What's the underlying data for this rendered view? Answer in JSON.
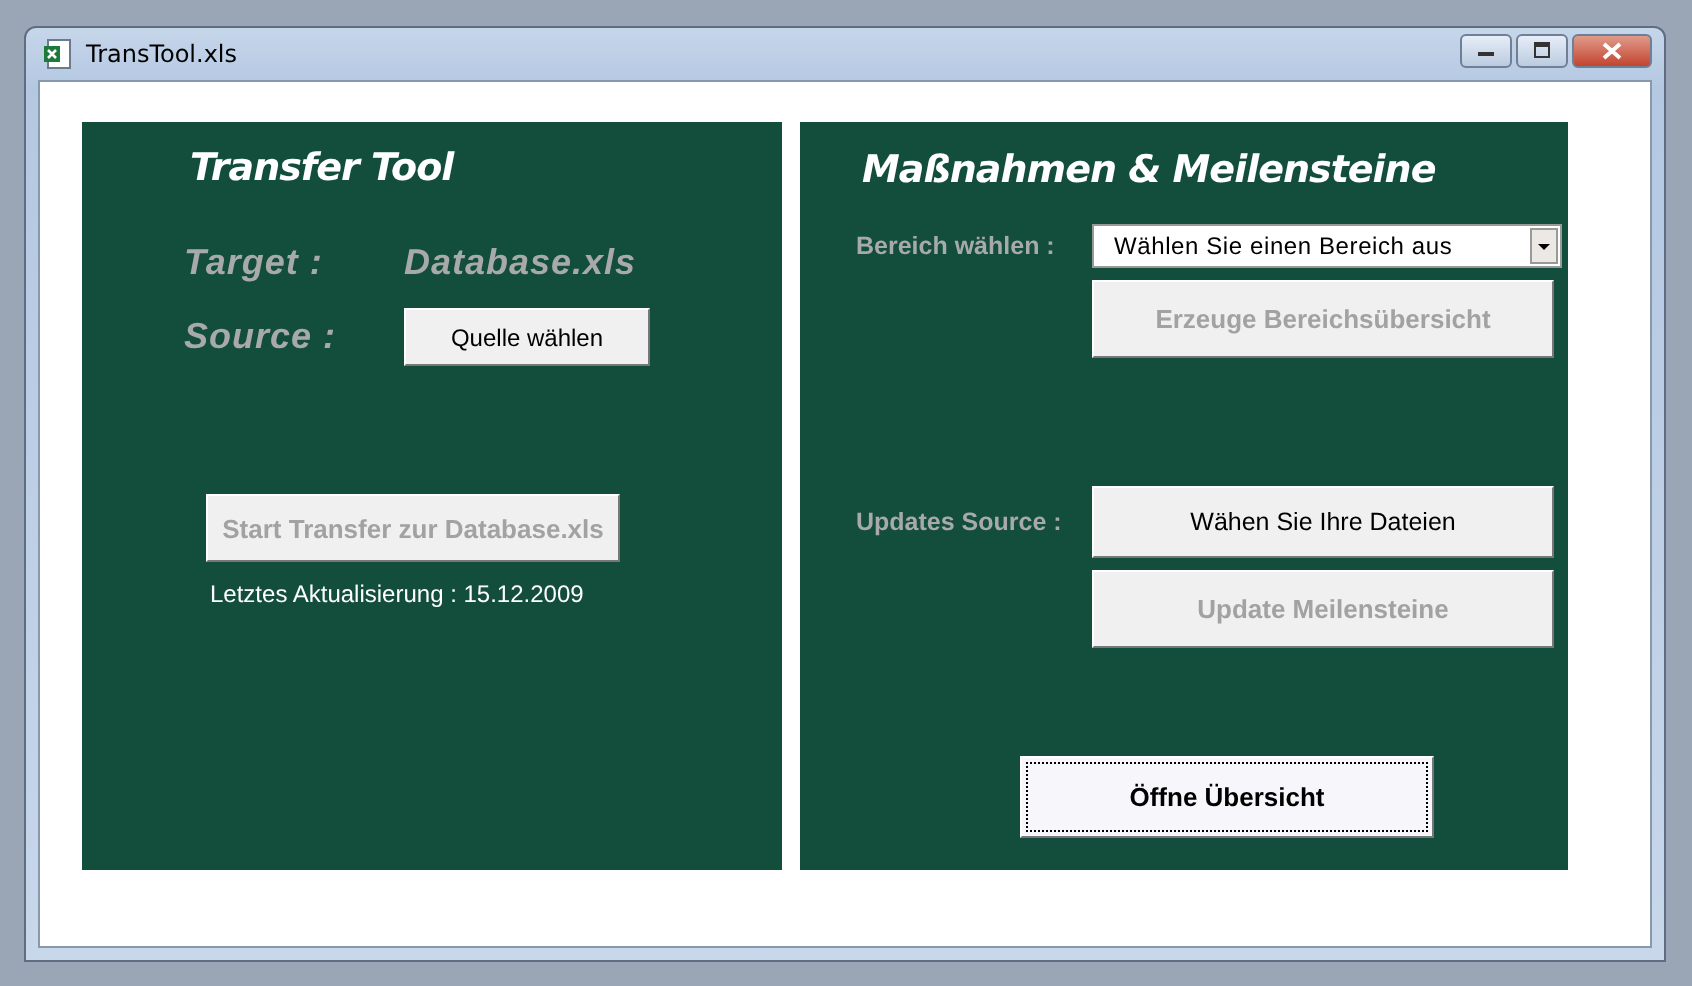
{
  "window": {
    "title": "TransTool.xls"
  },
  "transfer_panel": {
    "title": "Transfer Tool",
    "target": {
      "label": "Target :",
      "value": "Database.xls"
    },
    "source": {
      "label": "Source :",
      "button": {
        "label": "Quelle wählen",
        "disabled": false,
        "focused": false
      }
    },
    "start_button": {
      "label": "Start Transfer zur Database.xls",
      "disabled": true,
      "focused": false
    },
    "last_update": "Letztes Aktualisierung : 15.12.2009"
  },
  "milestones_panel": {
    "title": "Maßnahmen & Meilensteine",
    "area": {
      "label": "Bereich wählen :",
      "dropdown": "Wählen Sie einen Bereich aus",
      "button": {
        "label": "Erzeuge Bereichsübersicht",
        "disabled": true,
        "focused": false
      }
    },
    "updates": {
      "label": "Updates Source :",
      "buttons": [
        {
          "label": "Wähen Sie Ihre Dateien",
          "disabled": false,
          "focused": false
        },
        {
          "label": "Update Meilensteine",
          "disabled": true,
          "focused": false
        }
      ]
    },
    "open_button": {
      "label": "Öffne Übersicht",
      "disabled": false,
      "focused": true
    }
  }
}
